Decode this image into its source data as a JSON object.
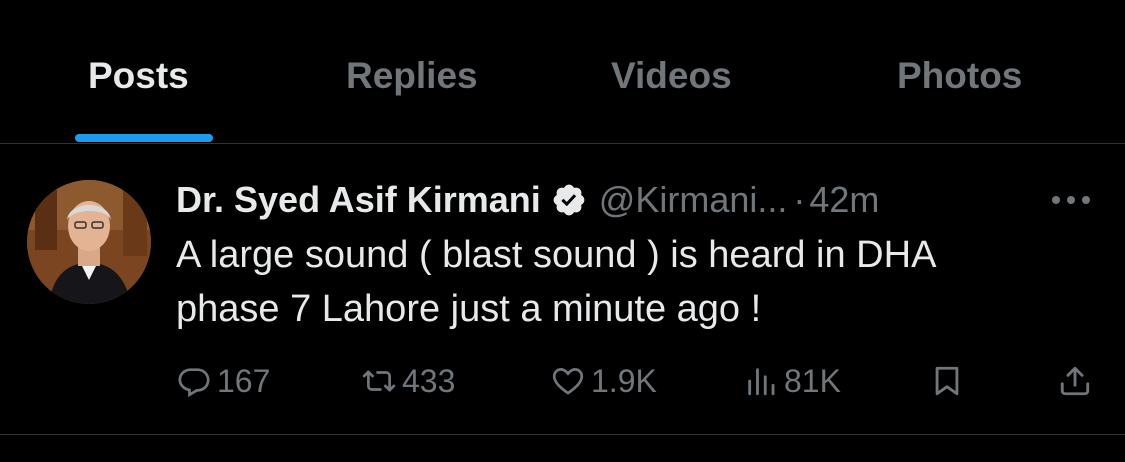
{
  "tabs": [
    {
      "label": "Posts",
      "active": true
    },
    {
      "label": "Replies",
      "active": false
    },
    {
      "label": "Videos",
      "active": false
    },
    {
      "label": "Photos",
      "active": false
    }
  ],
  "tweet": {
    "author_name": "Dr. Syed Asif Kirmani",
    "verified": true,
    "handle": "@Kirmani...",
    "separator": "·",
    "time": "42m",
    "text_lines": [
      "A large sound ( blast sound ) is heard in DHA",
      "phase 7 Lahore just a minute ago !"
    ],
    "stats": {
      "replies": "167",
      "reposts": "433",
      "likes": "1.9K",
      "views": "81K"
    }
  },
  "icons": {
    "verified": "verified-badge-icon",
    "more": "more-options-icon",
    "reply": "reply-icon",
    "repost": "repost-icon",
    "like": "heart-icon",
    "views": "views-chart-icon",
    "bookmark": "bookmark-icon",
    "share": "share-icon"
  },
  "colors": {
    "background": "#000000",
    "text_primary": "#e7e9ea",
    "text_secondary": "#71767b",
    "accent": "#1d9bf0",
    "divider": "#2f3336"
  }
}
